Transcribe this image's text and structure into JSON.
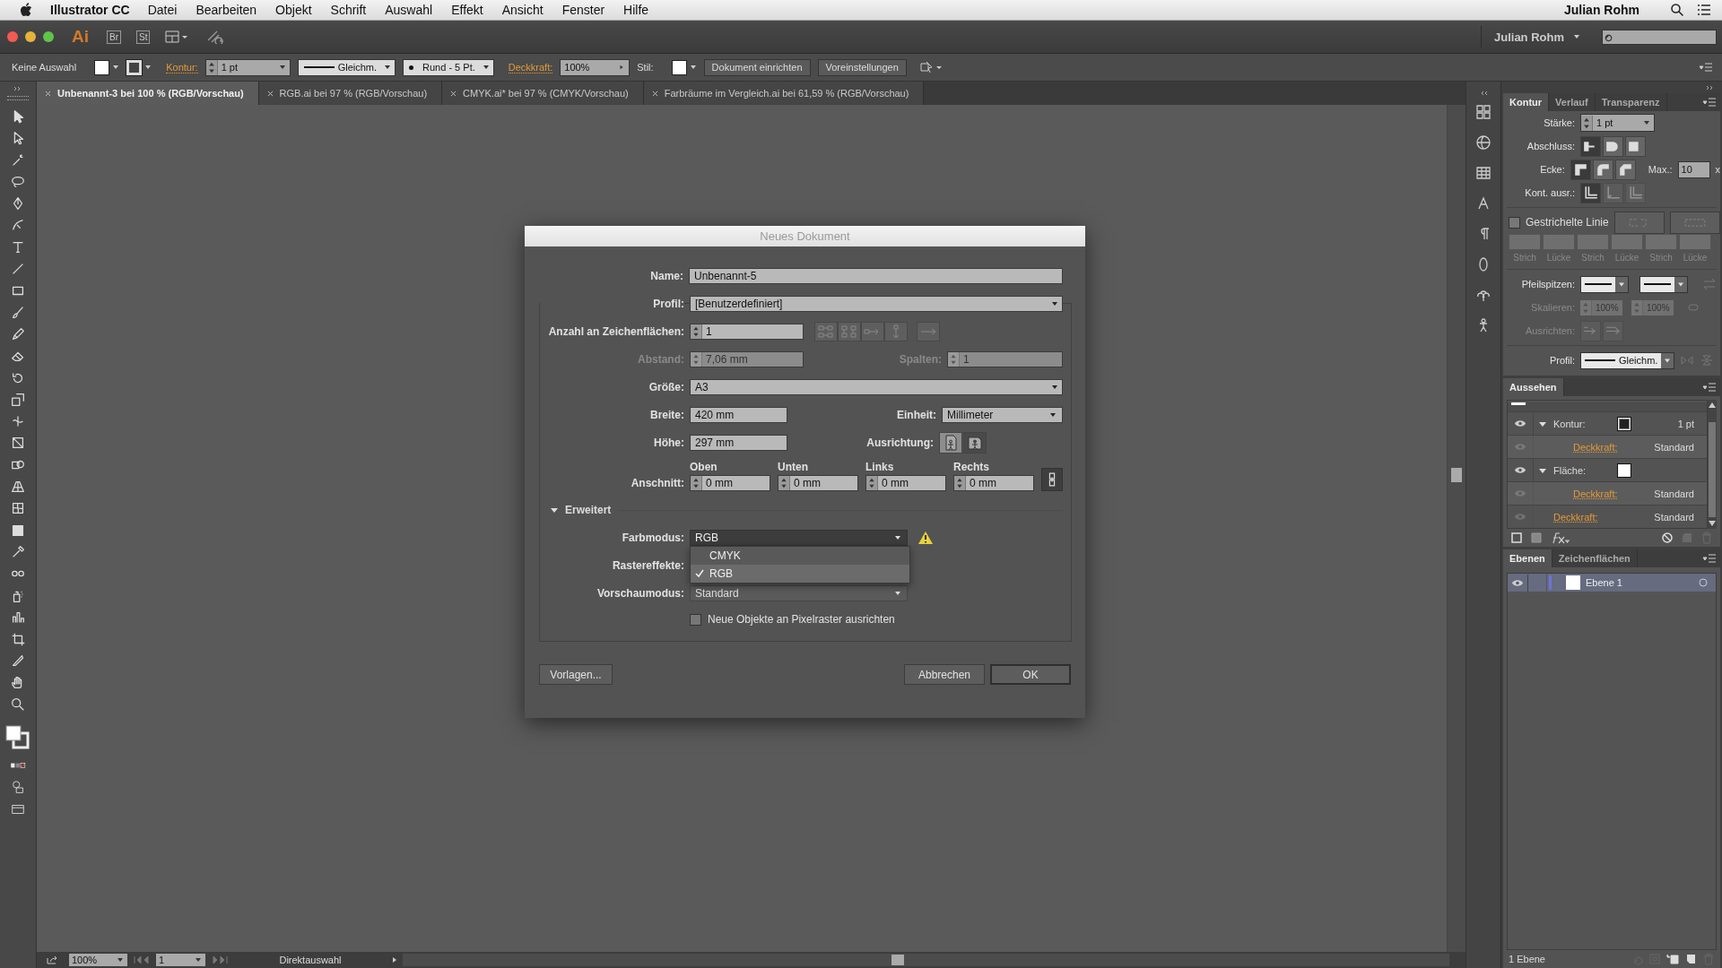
{
  "menu_bar": {
    "app_name": "Illustrator CC",
    "items": [
      "Datei",
      "Bearbeiten",
      "Objekt",
      "Schrift",
      "Auswahl",
      "Effekt",
      "Ansicht",
      "Fenster",
      "Hilfe"
    ],
    "user": "Julian Rohm"
  },
  "app_bar": {
    "logo": "Ai",
    "bridge": "Br",
    "stock": "St",
    "user": "Julian Rohm"
  },
  "control_bar": {
    "selection": "Keine Auswahl",
    "stroke_label": "Kontur:",
    "stroke_weight": "1 pt",
    "stroke_profile": "Gleichm.",
    "brush": "Rund - 5 Pt.",
    "opacity_label": "Deckkraft:",
    "opacity": "100%",
    "style_label": "Stil:",
    "buttons": [
      "Dokument einrichten",
      "Voreinstellungen"
    ]
  },
  "tabs": [
    {
      "label": "Unbenannt-3 bei 100 % (RGB/Vorschau)",
      "selected": true
    },
    {
      "label": "RGB.ai bei 97 % (RGB/Vorschau)",
      "selected": false
    },
    {
      "label": "CMYK.ai* bei 97 % (CMYK/Vorschau)",
      "selected": false
    },
    {
      "label": "Farbräume im Vergleich.ai bei 61,59 % (RGB/Vorschau)",
      "selected": false
    }
  ],
  "dialog": {
    "title": "Neues Dokument",
    "name": {
      "label": "Name:",
      "value": "Unbenannt-5"
    },
    "profile": {
      "label": "Profil:",
      "value": "[Benutzerdefiniert]"
    },
    "artboards": {
      "label": "Anzahl an Zeichenflächen:",
      "value": "1"
    },
    "spacing": {
      "label": "Abstand:",
      "value": "7,06 mm",
      "disabled": true
    },
    "columns": {
      "label": "Spalten:",
      "value": "1",
      "disabled": true
    },
    "size": {
      "label": "Größe:",
      "value": "A3"
    },
    "width": {
      "label": "Breite:",
      "value": "420 mm"
    },
    "unit": {
      "label": "Einheit:",
      "value": "Millimeter"
    },
    "height": {
      "label": "Höhe:",
      "value": "297 mm"
    },
    "orientation": {
      "label": "Ausrichtung:",
      "options": [
        {
          "kind": "portrait",
          "selected": false
        },
        {
          "kind": "landscape",
          "selected": true
        }
      ]
    },
    "bleed": {
      "label": "Anschnitt:",
      "fields": [
        {
          "heading": "Oben",
          "value": "0 mm"
        },
        {
          "heading": "Unten",
          "value": "0 mm"
        },
        {
          "heading": "Links",
          "value": "0 mm"
        },
        {
          "heading": "Rechts",
          "value": "0 mm"
        }
      ]
    },
    "advanced": {
      "label": "Erweitert",
      "expanded": true
    },
    "color_mode": {
      "label": "Farbmodus:",
      "value": "RGB",
      "warning": true,
      "open": true,
      "options": [
        {
          "label": "CMYK",
          "selected": false
        },
        {
          "label": "RGB",
          "selected": true
        }
      ]
    },
    "raster": {
      "label": "Rastereffekte:"
    },
    "preview": {
      "label": "Vorschaumodus:",
      "value": "Standard"
    },
    "pixel_grid": {
      "label": "Neue Objekte an Pixelraster ausrichten",
      "checked": false
    },
    "buttons": {
      "templates": "Vorlagen...",
      "cancel": "Abbrechen",
      "ok": "OK"
    }
  },
  "stroke_panel": {
    "tabs": [
      {
        "label": "Kontur",
        "selected": true
      },
      {
        "label": "Verlauf",
        "selected": false
      },
      {
        "label": "Transparenz",
        "selected": false
      }
    ],
    "weight": {
      "label": "Stärke:",
      "value": "1 pt"
    },
    "cap": {
      "label": "Abschluss:",
      "options": [
        {
          "selected": true
        },
        {
          "selected": false
        },
        {
          "selected": false
        }
      ]
    },
    "corner": {
      "label": "Ecke:",
      "options": [
        {
          "selected": true
        },
        {
          "selected": false
        },
        {
          "selected": false
        }
      ],
      "limit_label": "Max.:",
      "limit": "10",
      "limit_unit": "x"
    },
    "align": {
      "label": "Kont. ausr.:",
      "options": [
        {
          "selected": true,
          "disabled": false
        },
        {
          "selected": false,
          "disabled": true
        },
        {
          "selected": false,
          "disabled": true
        }
      ]
    },
    "dashed": {
      "label": "Gestrichelte Linie",
      "checked": false
    },
    "dash_fields": [
      "Strich",
      "Lücke",
      "Strich",
      "Lücke",
      "Strich",
      "Lücke"
    ],
    "arrowheads": {
      "label": "Pfeilspitzen:"
    },
    "scale": {
      "label": "Skalieren:",
      "values": [
        "100%",
        "100%"
      ],
      "disabled": true
    },
    "arrow_align": {
      "label": "Ausrichten:",
      "disabled": true
    },
    "profile": {
      "label": "Profil:",
      "value": "Gleichm."
    }
  },
  "appearance_panel": {
    "title": "Aussehen",
    "items": [
      {
        "kind": "stroke",
        "label": "Kontur:",
        "value": "1 pt",
        "visible": true,
        "expanded": true,
        "children": [
          {
            "kind": "opacity",
            "label": "Deckkraft:",
            "value": "Standard",
            "visible": false
          }
        ]
      },
      {
        "kind": "fill",
        "label": "Fläche:",
        "visible": true,
        "expanded": true,
        "children": [
          {
            "kind": "opacity",
            "label": "Deckkraft:",
            "value": "Standard",
            "visible": false
          }
        ]
      },
      {
        "kind": "opacity",
        "label": "Deckkraft:",
        "value": "Standard",
        "visible": false
      }
    ]
  },
  "layers_panel": {
    "tabs": [
      {
        "label": "Ebenen",
        "selected": true
      },
      {
        "label": "Zeichenflächen",
        "selected": false
      }
    ],
    "layers": [
      {
        "name": "Ebene 1",
        "color": "#6b74d6",
        "selected": true,
        "visible": true
      }
    ],
    "footer": "1 Ebene"
  },
  "status_bar": {
    "zoom": "100%",
    "artboard": "1",
    "tool": "Direktauswahl"
  }
}
